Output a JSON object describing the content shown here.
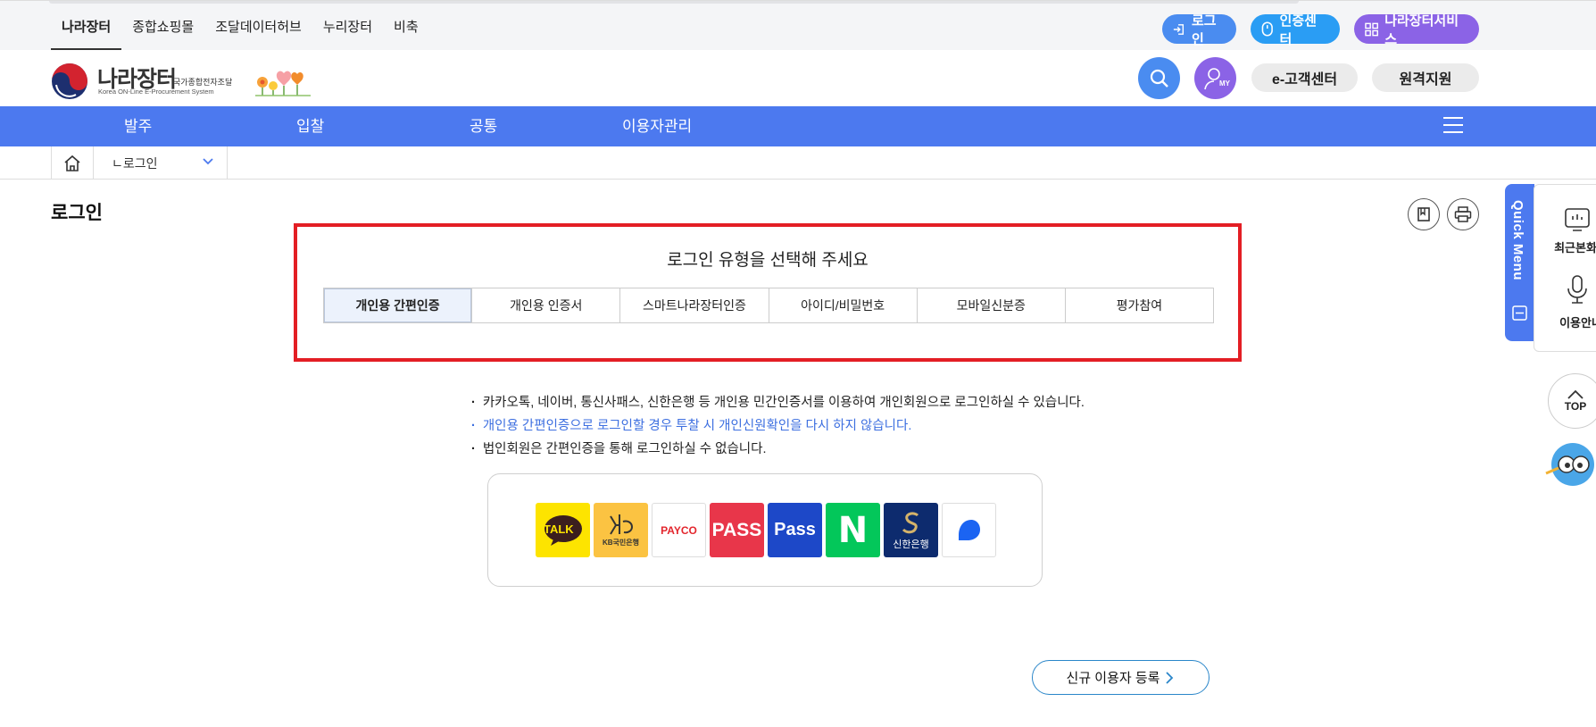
{
  "topbar": {
    "links": [
      "나라장터",
      "종합쇼핑몰",
      "조달데이터허브",
      "누리장터",
      "비축"
    ],
    "login_label": "로그인",
    "cert_label": "인증센터",
    "service_label": "나라장터서비스"
  },
  "header": {
    "logo_main": "나라장터",
    "logo_sub_kr": "국가종합전자조달",
    "logo_sub_en": "Korea ON-Line E-Procurement System",
    "my_label": "MY",
    "cs_label": "e-고객센터",
    "remote_label": "원격지원"
  },
  "nav": {
    "items": [
      "발주",
      "입찰",
      "공통",
      "이용자관리"
    ]
  },
  "breadcrumb": {
    "current": "ㄴ로그인"
  },
  "page": {
    "title": "로그인"
  },
  "login_panel": {
    "title": "로그인 유형을 선택해 주세요",
    "tabs": [
      "개인용 간편인증",
      "개인용 인증서",
      "스마트나라장터인증",
      "아이디/비밀번호",
      "모바일신분증",
      "평가참여"
    ],
    "active_tab": "개인용 간편인증"
  },
  "notices": [
    "카카오톡, 네이버, 통신사패스, 신한은행 등 개인용 민간인증서를 이용하여 개인회원으로 로그인하실 수 있습니다.",
    "개인용 간편인증으로 로그인할 경우 투찰 시 개인신원확인을 다시 하지 않습니다.",
    "법인회원은 간편인증을 통해 로그인하실 수 없습니다."
  ],
  "providers": {
    "kakao": "TALK",
    "kb_label": "KB국민은행",
    "payco": "PAYCO",
    "pass1": "PASS",
    "pass2": "Pass",
    "naver": "N",
    "shinhan": "신한은행"
  },
  "register_label": "신규 이용자 등록",
  "quick_menu": {
    "label": "Quick Menu",
    "item1": "최근본화면",
    "item2": "이용안내",
    "top_label": "TOP"
  },
  "colors": {
    "nav_bg": "#4c79ef",
    "highlight_border": "#e31e24",
    "notice_blue": "#3d6fe0"
  }
}
